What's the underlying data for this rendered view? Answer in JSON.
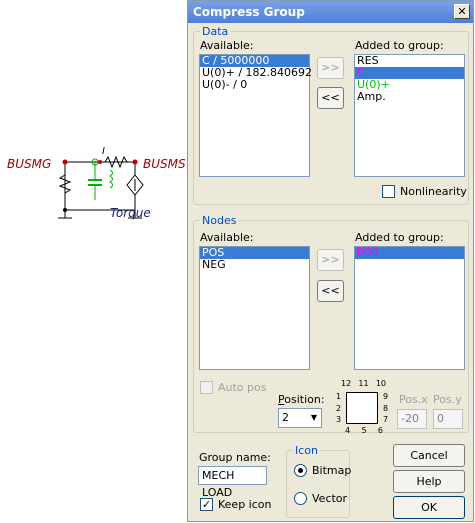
{
  "circuit": {
    "labels": {
      "busmg": "BUSMG",
      "busms": "BUSMS",
      "torque": "Torque",
      "current_marker": "I"
    }
  },
  "dialog": {
    "title": "Compress Group",
    "close": "✕",
    "data_section": {
      "legend": "Data",
      "available_label": "Available:",
      "added_label": "Added to group:",
      "available_items": [
        "C / 5000000",
        "U(0)+ / 182.840692",
        "U(0)- / 0"
      ],
      "available_selected_index": 0,
      "added_items": [
        {
          "text": "RES",
          "color": "#000000"
        },
        {
          "text": "C",
          "color": "#ff00ff"
        },
        {
          "text": "U(0)+",
          "color": "#00c000"
        },
        {
          "text": "Amp.",
          "color": "#000000"
        }
      ],
      "added_selected_index": 1,
      "add_button": ">>",
      "remove_button": "<<",
      "nonlinearity_label": "Nonlinearity",
      "nonlinearity_checked": false
    },
    "nodes_section": {
      "legend": "Nodes",
      "available_label": "Available:",
      "added_label": "Added to group:",
      "available_items": [
        "POS",
        "NEG"
      ],
      "available_selected_index": 0,
      "added_items": [
        {
          "text": "POS",
          "color": "#ff00ff"
        }
      ],
      "added_selected_index": 0,
      "add_button": ">>",
      "remove_button": "<<",
      "auto_pos_label": "Auto pos",
      "position_label": "Position:",
      "position_value": "2",
      "pos_x_label": "Pos.x",
      "pos_y_label": "Pos.y",
      "pos_x_value": "-20",
      "pos_y_value": "0",
      "pin_numbers": {
        "top": [
          "12",
          "11",
          "10"
        ],
        "left": [
          "1",
          "2",
          "3"
        ],
        "right": [
          "9",
          "8",
          "7"
        ],
        "bottom": [
          "4",
          "5",
          "6"
        ]
      }
    },
    "group_name_label": "Group name:",
    "group_name_value": "MECH LOAD",
    "keep_icon_label": "Keep icon",
    "keep_icon_checked": true,
    "icon_section": {
      "legend": "Icon",
      "bitmap_label": "Bitmap",
      "vector_label": "Vector",
      "selected": "bitmap"
    },
    "buttons": {
      "cancel": "Cancel",
      "help": "Help",
      "ok": "OK"
    }
  }
}
